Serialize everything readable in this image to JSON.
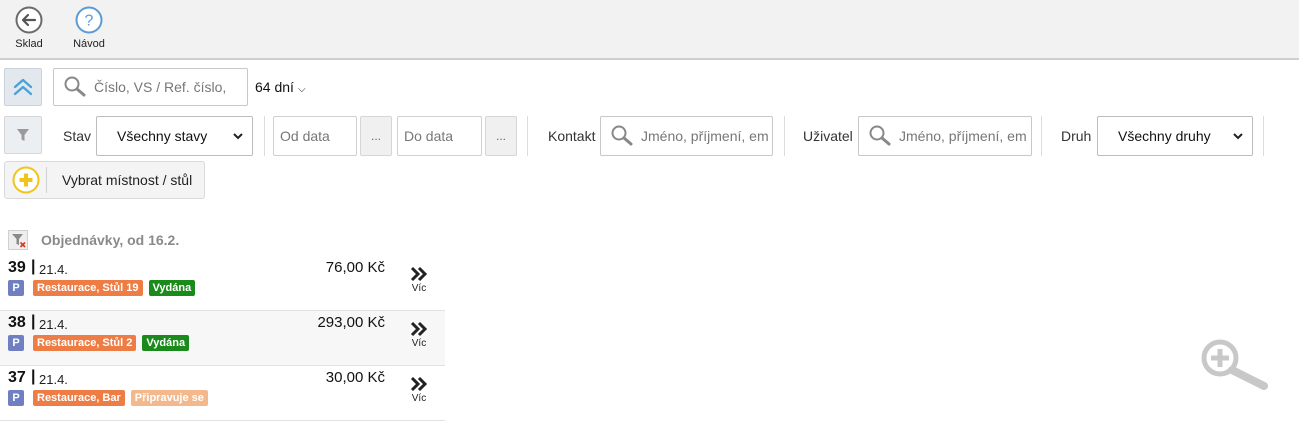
{
  "toolbar": {
    "back_label": "Sklad",
    "help_label": "Návod"
  },
  "search": {
    "placeholder": "Číslo, VS / Ref. číslo,",
    "period_label": "64 dní"
  },
  "filters": {
    "status_label": "Stav",
    "status_value": "Všechny stavy",
    "from_placeholder": "Od data",
    "to_placeholder": "Do data",
    "dots_label": "...",
    "contact_label": "Kontakt",
    "contact_placeholder": "Jméno, příjmení, em",
    "user_label": "Uživatel",
    "user_placeholder": "Jméno, příjmení, em",
    "type_label": "Druh",
    "type_value": "Všechny druhy",
    "room_label": "Vybrat místnost / stůl"
  },
  "list": {
    "title": "Objednávky, od 16.2.",
    "more_label": "Víc",
    "orders": [
      {
        "number": "39",
        "separator": "|",
        "date": "21.4.",
        "amount": "76,00 Kč",
        "type_badge": "P",
        "location": "Restaurace, Stůl 19",
        "status": "Vydána",
        "status_color": "#1a8a1a"
      },
      {
        "number": "38",
        "separator": "|",
        "date": "21.4.",
        "amount": "293,00 Kč",
        "type_badge": "P",
        "location": "Restaurace, Stůl 2",
        "status": "Vydána",
        "status_color": "#1a8a1a"
      },
      {
        "number": "37",
        "separator": "|",
        "date": "21.4.",
        "amount": "30,00 Kč",
        "type_badge": "P",
        "location": "Restaurace, Bar",
        "status": "Připravuje se",
        "status_color": "#f3b98c"
      }
    ]
  },
  "colors": {
    "location_badge": "#ee7d45",
    "type_badge": "#6f7fc2",
    "accent_blue": "#5b9bd5"
  }
}
